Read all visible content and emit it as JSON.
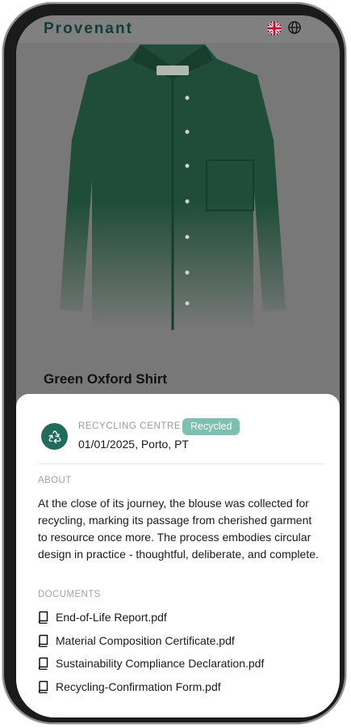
{
  "app": {
    "brand": "Provenant",
    "language_flag": "uk-flag-icon",
    "language_icon": "globe-icon"
  },
  "product": {
    "title": "Green Oxford Shirt"
  },
  "event": {
    "icon": "recycle-icon",
    "type": "RECYCLING CENTRE",
    "status": "Recycled",
    "date_location": "01/01/2025, Porto, PT",
    "accent": "#1f6b5c",
    "badge_color": "#7fbfb0"
  },
  "about": {
    "label": "ABOUT",
    "text": "At the close of its journey, the blouse was collected for recycling, marking its passage from cherished garment to resource once more. The process embodies circular design in practice - thoughtful, deliberate, and complete."
  },
  "documents": {
    "label": "DOCUMENTS",
    "items": [
      {
        "name": "End-of-Life Report.pdf",
        "icon": "book-icon"
      },
      {
        "name": "Material Composition Certificate.pdf",
        "icon": "book-icon"
      },
      {
        "name": "Sustainability Compliance Declaration.pdf",
        "icon": "book-icon"
      },
      {
        "name": "Recycling-Confirmation Form.pdf",
        "icon": "book-icon"
      }
    ]
  }
}
